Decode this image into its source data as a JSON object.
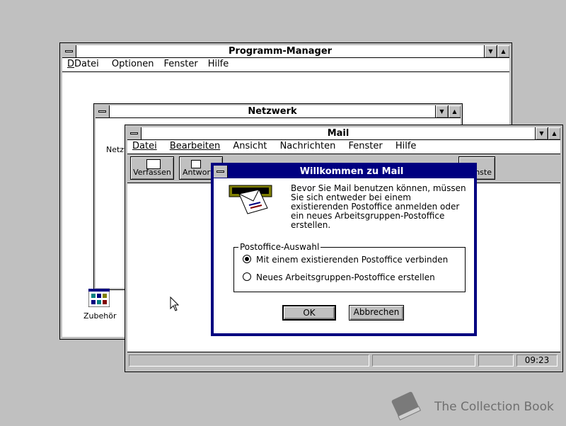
{
  "program_manager": {
    "title": "Programm-Manager",
    "menu": [
      "Datei",
      "Optionen",
      "Fenster",
      "Hilfe"
    ],
    "icons": {
      "zubehoer": "Zubehör"
    }
  },
  "netzwerk": {
    "title": "Netzwerk",
    "icon_label_partial": "Netzv"
  },
  "mail": {
    "title": "Mail",
    "menu": [
      "Datei",
      "Bearbeiten",
      "Ansicht",
      "Nachrichten",
      "Fenster",
      "Hilfe"
    ],
    "toolbar": {
      "compose": "Verfassen",
      "reply": "Antworte",
      "next": "ichste"
    },
    "status": {
      "time": "09:23"
    }
  },
  "dialog": {
    "title": "Willkommen zu Mail",
    "message": "Bevor Sie Mail benutzen können, müssen Sie sich entweder bei einem existierenden Postoffice anmelden oder ein neues Arbeitsgruppen-Postoffice erstellen.",
    "group_label": "Postoffice-Auswahl",
    "option1": "Mit einem existierenden Postoffice verbinden",
    "option2": "Neues Arbeitsgruppen-Postoffice erstellen",
    "selected": 1,
    "ok": "OK",
    "cancel": "Abbrechen"
  },
  "watermark": {
    "text": "The Collection Book"
  },
  "colors": {
    "desktop": "#c0c0c0",
    "active_title": "#000080"
  },
  "icons": [
    "system-menu-icon",
    "minimize-icon",
    "maximize-icon",
    "mail-envelope-icon",
    "program-group-icon",
    "book-icon",
    "mouse-cursor-icon"
  ]
}
